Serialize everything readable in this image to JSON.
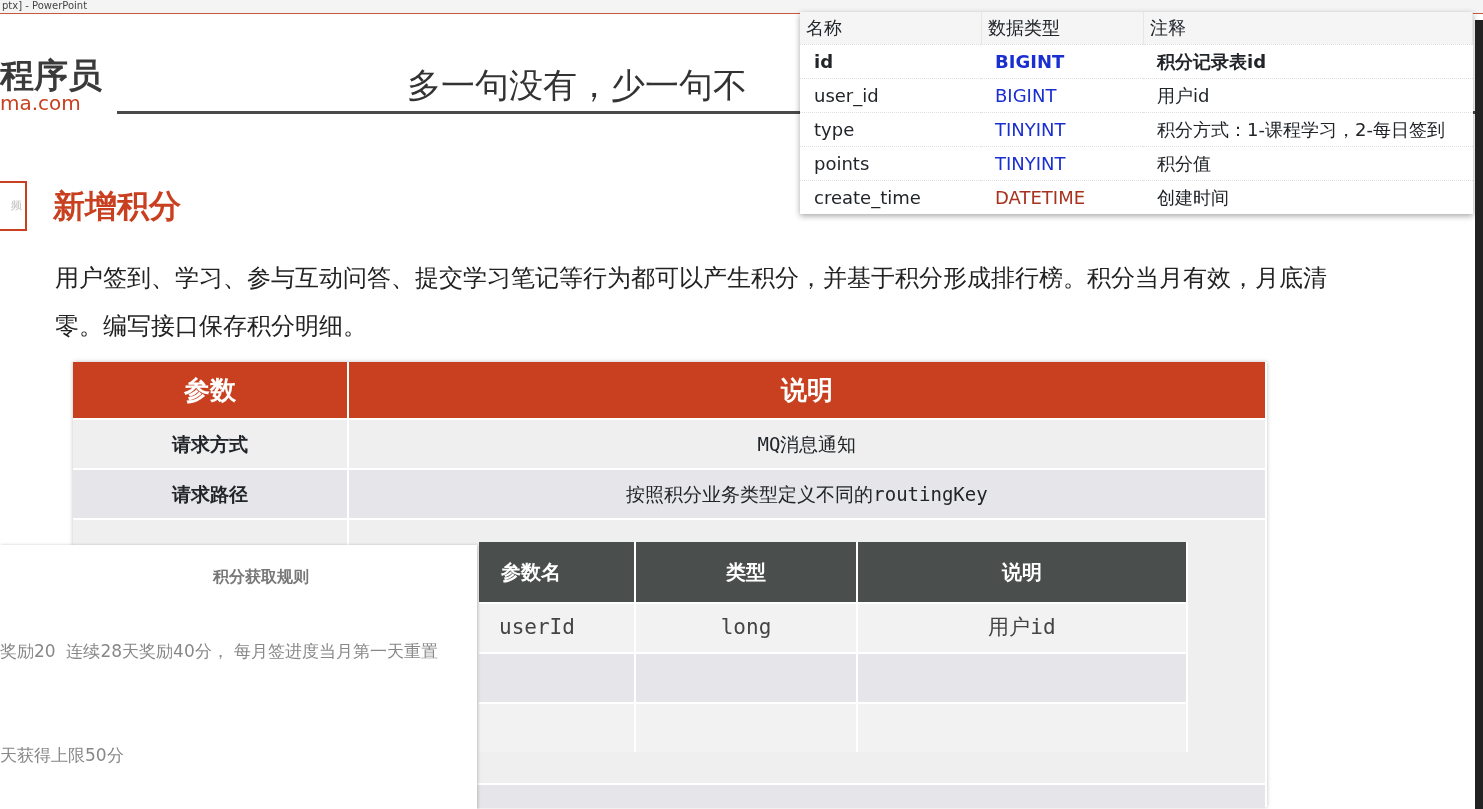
{
  "window": {
    "title": "ptx] - PowerPoint"
  },
  "slide": {
    "logo": {
      "name": "程序员",
      "domain": "ma.com"
    },
    "slogan": "多一句没有，少一句不",
    "section": {
      "badge": "频",
      "title": "新增积分"
    },
    "description": "用户签到、学习、参与互动问答、提交学习笔记等行为都可以产生积分，并基于积分形成排行榜。积分当月有效，月底清零。编写接口保存积分明细。",
    "api_table": {
      "columns": [
        "参数",
        "说明"
      ],
      "rows": [
        {
          "label": "请求方式",
          "value": "MQ消息通知"
        },
        {
          "label": "请求路径",
          "value": "按照积分业务类型定义不同的routingKey"
        }
      ],
      "params": {
        "columns": [
          "参数名",
          "类型",
          "说明"
        ],
        "rows": [
          [
            "userId",
            "long",
            "用户id"
          ]
        ]
      }
    }
  },
  "db_table": {
    "columns": [
      "名称",
      "数据类型",
      "注释"
    ],
    "rows": [
      {
        "name": "id",
        "type": "BIGINT",
        "comment": "积分记录表id",
        "primary_key": true,
        "color": "#1a2fd0"
      },
      {
        "name": "user_id",
        "type": "BIGINT",
        "comment": "用户id",
        "primary_key": false,
        "color": "#1a2fd0"
      },
      {
        "name": "type",
        "type": "TINYINT",
        "comment": "积分方式：1-课程学习，2-每日签到",
        "primary_key": false,
        "color": "#1a2fd0"
      },
      {
        "name": "points",
        "type": "TINYINT",
        "comment": "积分值",
        "primary_key": false,
        "color": "#1a2fd0"
      },
      {
        "name": "create_time",
        "type": "DATETIME",
        "comment": "创建时间",
        "primary_key": false,
        "color": "#a8321e"
      }
    ]
  },
  "rules_panel": {
    "title": "积分获取规则",
    "lines": [
      "奖励20  连续28天奖励40分， 每月签进度当月第一天重置",
      "天获得上限50分"
    ]
  }
}
